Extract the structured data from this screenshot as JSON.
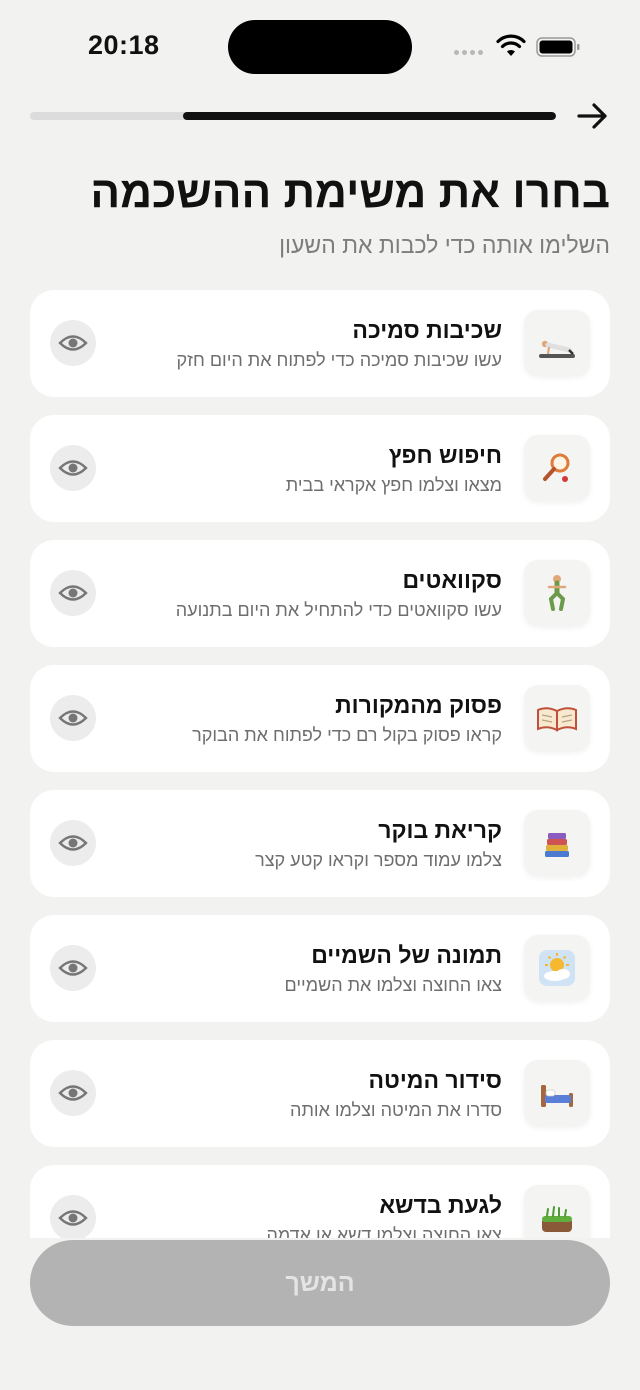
{
  "status_bar": {
    "time": "20:18"
  },
  "progress": {
    "fraction": 0.71
  },
  "header": {
    "title": "בחרו את משימת ההשכמה",
    "subtitle": "השלימו אותה כדי לכבות את השעון"
  },
  "tasks": [
    {
      "title": "שכיבות סמיכה",
      "desc": "עשו שכיבות סמיכה כדי לפתוח את היום חזק",
      "icon": "pushup-icon"
    },
    {
      "title": "חיפוש חפץ",
      "desc": "מצאו וצלמו חפץ אקראי בבית",
      "icon": "magnifier-icon"
    },
    {
      "title": "סקוואטים",
      "desc": "עשו סקוואטים כדי להתחיל את היום בתנועה",
      "icon": "squat-icon"
    },
    {
      "title": "פסוק מהמקורות",
      "desc": "קראו פסוק בקול רם כדי לפתוח את הבוקר",
      "icon": "open-book-icon"
    },
    {
      "title": "קריאת בוקר",
      "desc": "צלמו עמוד מספר וקראו קטע קצר",
      "icon": "books-stack-icon"
    },
    {
      "title": "תמונה של השמיים",
      "desc": "צאו החוצה וצלמו את השמיים",
      "icon": "sun-cloud-icon"
    },
    {
      "title": "סידור המיטה",
      "desc": "סדרו את המיטה וצלמו אותה",
      "icon": "bed-icon"
    },
    {
      "title": "לגעת בדשא",
      "desc": "צאו החוצה וצלמו דשא או אדמה",
      "icon": "grass-icon"
    }
  ],
  "continue_button": {
    "label": "המשך"
  },
  "colors": {
    "background": "#f2f2f0",
    "card": "#ffffff",
    "accent": "#111111",
    "disabled_button": "#b3b3b3"
  }
}
